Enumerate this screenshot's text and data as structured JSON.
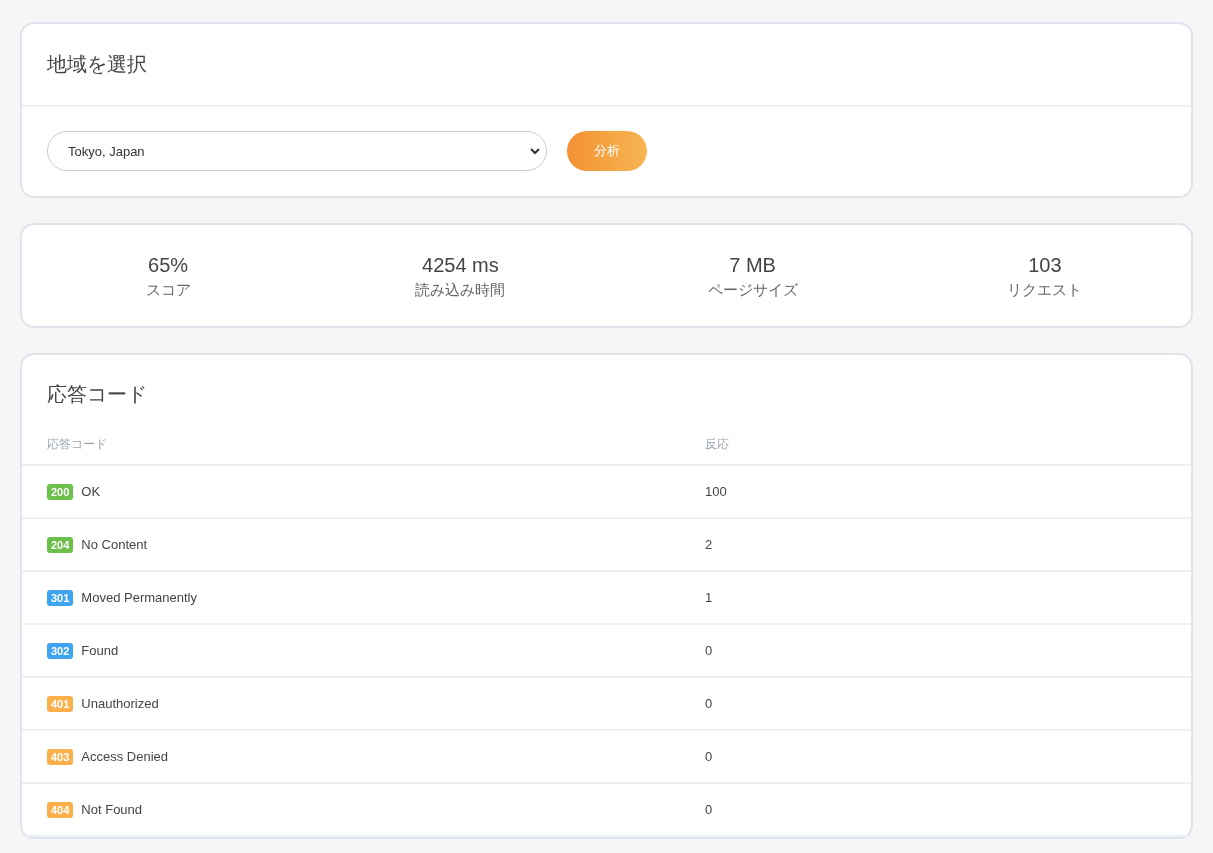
{
  "region_card": {
    "title": "地域を選択",
    "select_value": "Tokyo, Japan",
    "button": "分析"
  },
  "stats": [
    {
      "value": "65%",
      "label": "スコア"
    },
    {
      "value": "4254 ms",
      "label": "読み込み時間"
    },
    {
      "value": "7 MB",
      "label": "ページサイズ"
    },
    {
      "value": "103",
      "label": "リクエスト"
    }
  ],
  "response_codes": {
    "title": "応答コード",
    "columns": [
      "応答コード",
      "反応"
    ],
    "rows": [
      {
        "code": "200",
        "color": "#6cc04a",
        "label": "OK",
        "count": "100"
      },
      {
        "code": "204",
        "color": "#6cc04a",
        "label": "No Content",
        "count": "2"
      },
      {
        "code": "301",
        "color": "#3fa4ef",
        "label": "Moved Permanently",
        "count": "1"
      },
      {
        "code": "302",
        "color": "#3fa4ef",
        "label": "Found",
        "count": "0"
      },
      {
        "code": "401",
        "color": "#fbb04b",
        "label": "Unauthorized",
        "count": "0"
      },
      {
        "code": "403",
        "color": "#fbb04b",
        "label": "Access Denied",
        "count": "0"
      },
      {
        "code": "404",
        "color": "#fbb04b",
        "label": "Not Found",
        "count": "0"
      }
    ]
  }
}
